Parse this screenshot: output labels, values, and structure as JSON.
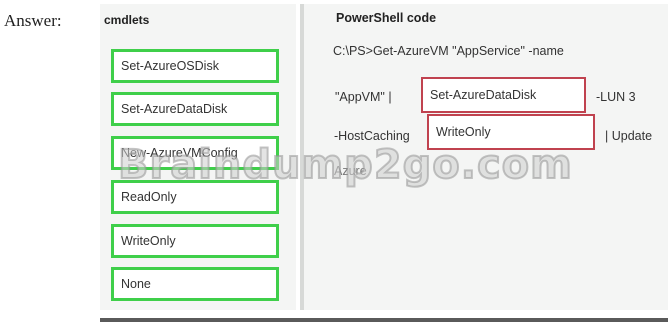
{
  "answer_label": "Answer:",
  "left_panel": {
    "title": "cmdlets",
    "items": [
      {
        "label": "Set-AzureOSDisk"
      },
      {
        "label": "Set-AzureDataDisk"
      },
      {
        "label": "New-AzureVMConfig"
      },
      {
        "label": "ReadOnly"
      },
      {
        "label": "WriteOnly"
      },
      {
        "label": "None"
      }
    ]
  },
  "code_panel": {
    "title": "PowerShell code",
    "line1": "C:\\PS>Get-AzureVM \"AppService\" -name",
    "line2_prefix": "\"AppVM\" |",
    "slot1": "Set-AzureDataDisk",
    "line2_suffix": "-LUN 3",
    "line3_prefix": "-HostCaching",
    "slot2": "WriteOnly",
    "line3_suffix": "| Update",
    "line4_partial": "Azure"
  },
  "watermark": "Braindump2go.com",
  "colors": {
    "cmdlet_border": "#3fcf4a",
    "slot_border": "#c0424f",
    "panel_bg": "#f4f5f4"
  }
}
